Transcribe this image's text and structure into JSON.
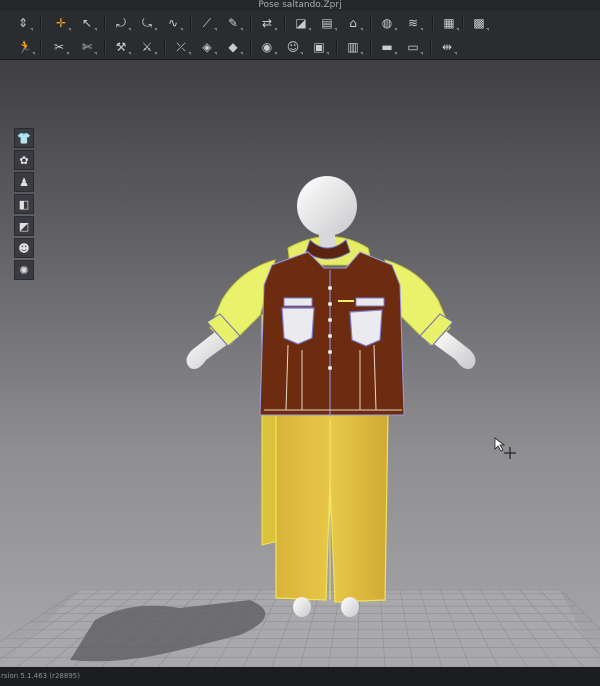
{
  "window": {
    "title": "Pose saltando.Zprj"
  },
  "status": {
    "version": "rsion 5.1.463 (r28895)"
  },
  "toolbar_row1": [
    {
      "name": "transform-icon",
      "glyph": "⇕"
    },
    {
      "name": "move-icon",
      "glyph": "✛",
      "selected": true
    },
    {
      "name": "edit-pattern-icon",
      "glyph": "↖"
    },
    {
      "name": "sewing-icon",
      "glyph": "⤾"
    },
    {
      "name": "segment-sew-icon",
      "glyph": "⤿"
    },
    {
      "name": "free-sew-icon",
      "glyph": "∿"
    },
    {
      "name": "pin-icon",
      "glyph": "⟋"
    },
    {
      "name": "tack-icon",
      "glyph": "✎"
    },
    {
      "name": "strengthen-icon",
      "glyph": "⇄"
    },
    {
      "name": "fold-icon",
      "glyph": "◪"
    },
    {
      "name": "tape-icon",
      "glyph": "▤"
    },
    {
      "name": "arrange-icon",
      "glyph": "⌂"
    },
    {
      "name": "button-icon",
      "glyph": "◍"
    },
    {
      "name": "zipper-icon",
      "glyph": "≋"
    },
    {
      "name": "puckering-icon",
      "glyph": "▦"
    },
    {
      "name": "grid-icon",
      "glyph": "▩"
    }
  ],
  "toolbar_row2": [
    {
      "name": "avatar-pose-icon",
      "glyph": "🏃"
    },
    {
      "name": "measure-icon",
      "glyph": "✂"
    },
    {
      "name": "measure-edit-icon",
      "glyph": "✄"
    },
    {
      "name": "fit-map-icon",
      "glyph": "⚒"
    },
    {
      "name": "stress-map-icon",
      "glyph": "⚔"
    },
    {
      "name": "select-mesh-icon",
      "glyph": "⤫"
    },
    {
      "name": "pin-mesh-icon",
      "glyph": "◈"
    },
    {
      "name": "fabric-icon",
      "glyph": "◆"
    },
    {
      "name": "trim-icon",
      "glyph": "◉"
    },
    {
      "name": "button-place-icon",
      "glyph": "☺"
    },
    {
      "name": "graphic-icon",
      "glyph": "▣"
    },
    {
      "name": "texture-icon",
      "glyph": "▥"
    },
    {
      "name": "layer-icon",
      "glyph": "▬"
    },
    {
      "name": "ruler-icon",
      "glyph": "▭"
    },
    {
      "name": "split-icon",
      "glyph": "⇹"
    }
  ],
  "sidebar": [
    {
      "name": "garment-icon",
      "glyph": "👕"
    },
    {
      "name": "sewing-line-icon",
      "glyph": "✿"
    },
    {
      "name": "avatar-icon",
      "glyph": "♟"
    },
    {
      "name": "fabric-view-icon",
      "glyph": "◧"
    },
    {
      "name": "shading-icon",
      "glyph": "◩"
    },
    {
      "name": "avatar-skin-icon",
      "glyph": "☻"
    },
    {
      "name": "arrangement-point-icon",
      "glyph": "✺"
    }
  ]
}
